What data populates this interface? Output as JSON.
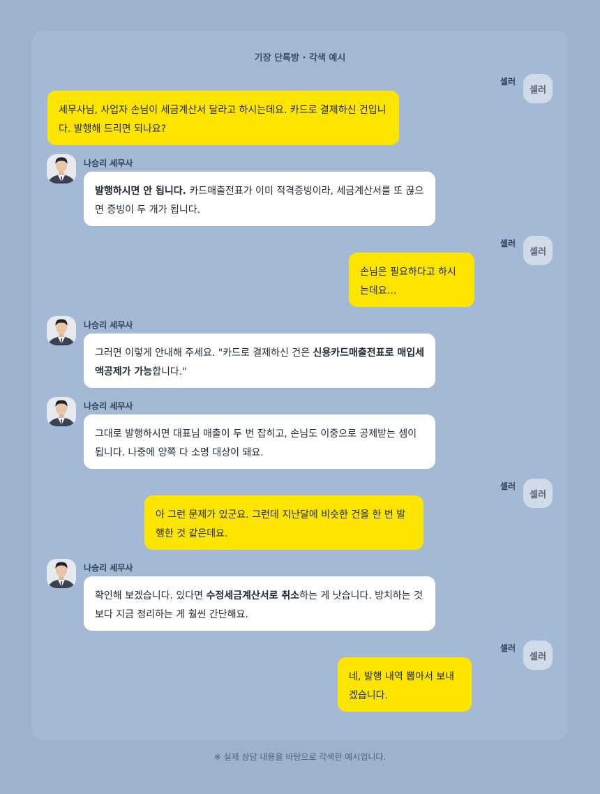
{
  "title": "기장 단톡방 · 각색 예시",
  "footer": "※ 실제 상담 내용을 바탕으로 각색한 예시입니다.",
  "colors": {
    "page_bg": "#9cb2cf",
    "panel_bg": "#a4b9d5",
    "seller_bubble": "#fee500",
    "pro_bubble": "#ffffff",
    "seller_avatar_bg": "#d1dbe8"
  },
  "messages": [
    {
      "sender": "셀러",
      "avatar": "셀러",
      "text": "세무사님, 사업자 손님이 세금계산서 달라고 하시는데요. 카드로 결제하신 건입니다. 발행해 드리면 되나요?"
    },
    {
      "sender": "나승리 세무사",
      "avatar_icon": "advisor-portrait-icon",
      "bold_1": "발행하시면 안 됩니다.",
      "text_1": " 카드매출전표가 이미 적격증빙이라, 세금계산서를 또 끊으면 증빙이 두 개가 됩니다."
    },
    {
      "sender": "셀러",
      "avatar": "셀러",
      "text": "손님은 필요하다고 하시는데요…"
    },
    {
      "sender": "나승리 세무사",
      "avatar_icon": "advisor-portrait-icon",
      "text_1": "그러면 이렇게 안내해 주세요. \"카드로 결제하신 건은 ",
      "bold_1": "신용카드매출전표로 매입세액공제가 가능",
      "text_2": "합니다.\""
    },
    {
      "sender": "나승리 세무사",
      "avatar_icon": "advisor-portrait-icon",
      "text": "그대로 발행하시면 대표님 매출이 두 번 잡히고, 손님도 이중으로 공제받는 셈이 됩니다. 나중에 양쪽 다 소명 대상이 돼요."
    },
    {
      "sender": "셀러",
      "avatar": "셀러",
      "text": "아 그런 문제가 있군요. 그런데 지난달에 비슷한 건을 한 번 발행한 것 같은데요."
    },
    {
      "sender": "나승리 세무사",
      "avatar_icon": "advisor-portrait-icon",
      "text_1": "확인해 보겠습니다. 있다면 ",
      "bold_1": "수정세금계산서로 취소",
      "text_2": "하는 게 낫습니다. 방치하는 것보다 지금 정리하는 게 훨씬 간단해요."
    },
    {
      "sender": "셀러",
      "avatar": "셀러",
      "text": "네, 발행 내역 뽑아서 보내겠습니다."
    }
  ]
}
